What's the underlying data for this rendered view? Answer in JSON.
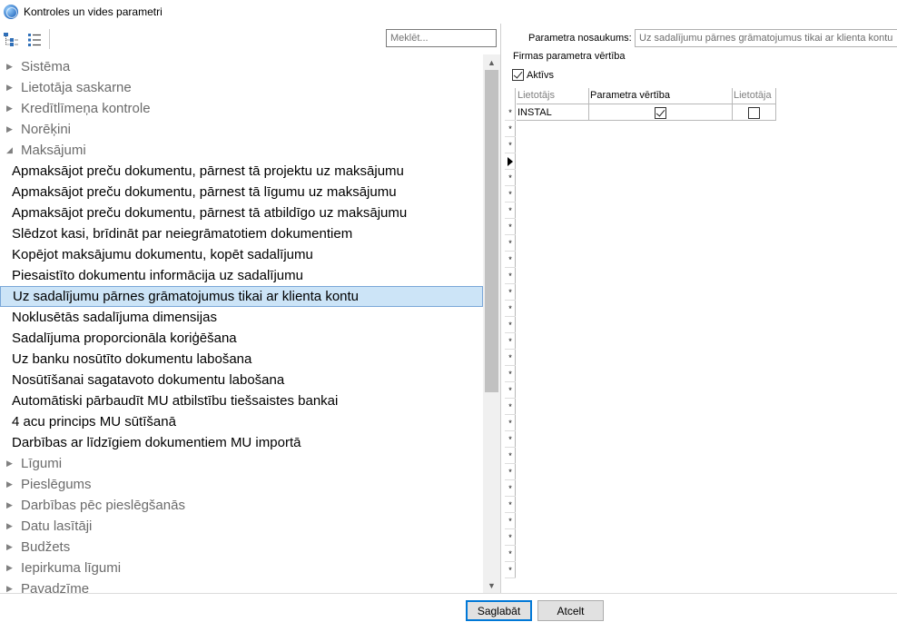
{
  "window": {
    "title": "Kontroles un vides parametri"
  },
  "toolbar": {
    "search_placeholder": "Meklēt..."
  },
  "tree": {
    "rows": [
      {
        "label": "Sistēma",
        "type": "group"
      },
      {
        "label": "Lietotāja saskarne",
        "type": "group"
      },
      {
        "label": "Kredītlīmeņa kontrole",
        "type": "group"
      },
      {
        "label": "Norēķini",
        "type": "group"
      },
      {
        "label": "Maksājumi",
        "type": "group-open"
      },
      {
        "label": "Apmaksājot preču dokumentu, pārnest tā projektu uz maksājumu",
        "type": "child"
      },
      {
        "label": "Apmaksājot preču dokumentu, pārnest tā līgumu uz maksājumu",
        "type": "child"
      },
      {
        "label": "Apmaksājot preču dokumentu, pārnest tā atbildīgo uz maksājumu",
        "type": "child"
      },
      {
        "label": "Slēdzot kasi, brīdināt par neiegrāmatotiem dokumentiem",
        "type": "child"
      },
      {
        "label": "Kopējot maksājumu dokumentu, kopēt sadalījumu",
        "type": "child"
      },
      {
        "label": "Piesaistīto dokumentu informācija uz sadalījumu",
        "type": "child"
      },
      {
        "label": "Uz sadalījumu pārnes grāmatojumus tikai ar klienta kontu",
        "type": "child",
        "selected": true
      },
      {
        "label": "Noklusētās sadalījuma dimensijas",
        "type": "child"
      },
      {
        "label": "Sadalījuma proporcionāla koriģēšana",
        "type": "child"
      },
      {
        "label": "Uz banku nosūtīto dokumentu labošana",
        "type": "child"
      },
      {
        "label": "Nosūtīšanai sagatavoto dokumentu labošana",
        "type": "child"
      },
      {
        "label": "Automātiski pārbaudīt MU atbilstību tiešsaistes bankai",
        "type": "child"
      },
      {
        "label": "4 acu princips MU sūtīšanā",
        "type": "child"
      },
      {
        "label": "Darbības ar līdzīgiem dokumentiem MU importā",
        "type": "child"
      },
      {
        "label": "Līgumi",
        "type": "group"
      },
      {
        "label": "Pieslēgums",
        "type": "group"
      },
      {
        "label": "Darbības pēc pieslēgšanās",
        "type": "group"
      },
      {
        "label": "Datu lasītāji",
        "type": "group"
      },
      {
        "label": "Budžets",
        "type": "group"
      },
      {
        "label": "Iepirkuma līgumi",
        "type": "group"
      },
      {
        "label": "Pavadzīme",
        "type": "group"
      }
    ]
  },
  "detail": {
    "param_name_label": "Parametra nosaukums:",
    "param_name_value": "Uz sadalījumu pārnes grāmatojumus tikai ar klienta kontu",
    "firm_label": "Firmas parametra vērtība",
    "active_label": "Aktīvs",
    "active_checked": true
  },
  "grid": {
    "columns": [
      "Lietotājs",
      "Parametra vērtība",
      "Lietotāja"
    ],
    "rows": [
      {
        "user": "INSTAL",
        "value_checked": true,
        "user_checked": false
      }
    ],
    "indicator_rows": 29,
    "current_row_index": 3
  },
  "buttons": {
    "save": "Saglabāt",
    "cancel": "Atcelt"
  }
}
